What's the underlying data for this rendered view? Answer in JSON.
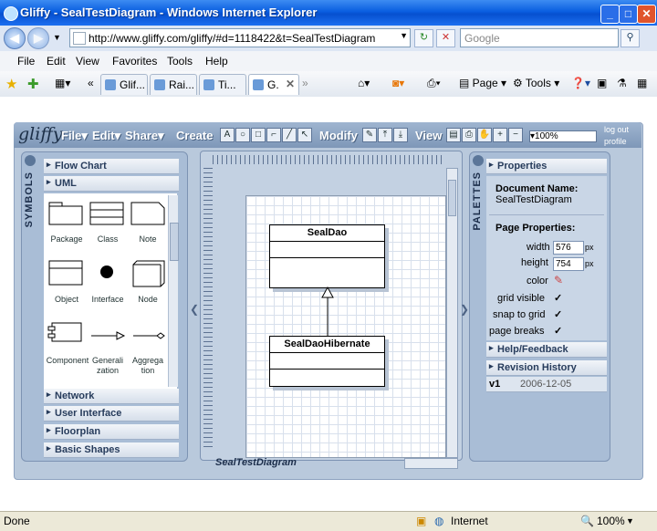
{
  "window": {
    "title": "Gliffy - SealTestDiagram - Windows Internet Explorer"
  },
  "address": {
    "url": "http://www.gliffy.com/gliffy/#d=1118422&t=SealTestDiagram",
    "search_placeholder": "Google"
  },
  "menu": [
    "File",
    "Edit",
    "View",
    "Favorites",
    "Tools",
    "Help"
  ],
  "tabs": [
    "Glif...",
    "Rai...",
    "Ti...",
    "G."
  ],
  "ie_tools": {
    "page": "Page",
    "tools": "Tools"
  },
  "app": {
    "logo": "gliffy",
    "toolbar": {
      "file": "File",
      "edit": "Edit",
      "share": "Share",
      "create": "Create",
      "modify": "Modify",
      "view": "View",
      "zoom": "100%",
      "logout": "log out",
      "profile": "profile"
    },
    "symbols": {
      "title": "SYMBOLS",
      "sections": [
        "Flow Chart",
        "UML",
        "Network",
        "User Interface",
        "Floorplan",
        "Basic Shapes"
      ],
      "uml_items": [
        "Package",
        "Class",
        "Note",
        "Object",
        "Interface",
        "Node",
        "Component",
        "Generalization",
        "Aggregation"
      ]
    },
    "canvas": {
      "footer": "SealTestDiagram",
      "classes": [
        {
          "name": "SealDao"
        },
        {
          "name": "SealDaoHibernate"
        }
      ]
    },
    "palettes": {
      "title": "PALETTES",
      "properties_title": "Properties",
      "doc_name_label": "Document Name:",
      "doc_name": "SealTestDiagram",
      "page_props_label": "Page Properties:",
      "width_label": "width",
      "width": "576",
      "height_label": "height",
      "height": "754",
      "unit": "px",
      "color_label": "color",
      "grid_visible": "grid visible",
      "snap_to_grid": "snap to grid",
      "page_breaks": "page breaks",
      "help_title": "Help/Feedback",
      "revision_title": "Revision History",
      "revision": {
        "version": "v1",
        "date": "2006-12-05"
      }
    }
  },
  "status": {
    "left": "Done",
    "zone": "Internet",
    "zoom": "100%"
  }
}
